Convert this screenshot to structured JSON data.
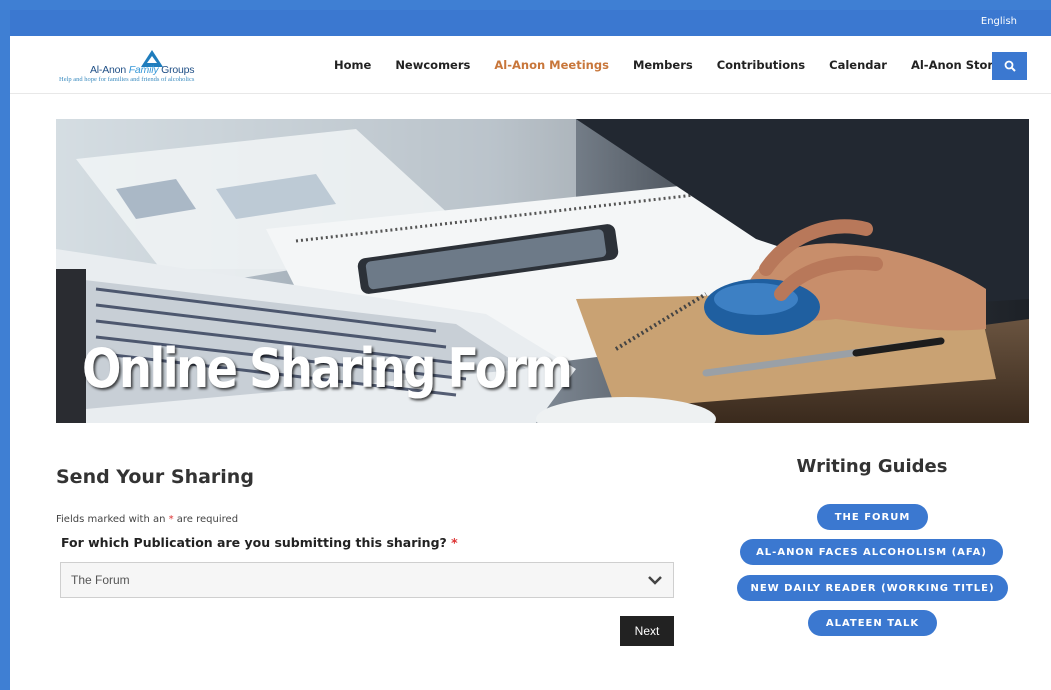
{
  "topbar": {
    "language": "English"
  },
  "logo": {
    "name_part1": "Al-Anon ",
    "name_part2": "Family",
    "name_part3": " Groups",
    "tagline": "Help and hope for families and friends of alcoholics"
  },
  "nav": {
    "items": [
      {
        "label": "Home",
        "active": false
      },
      {
        "label": "Newcomers",
        "active": false
      },
      {
        "label": "Al-Anon Meetings",
        "active": true
      },
      {
        "label": "Members",
        "active": false
      },
      {
        "label": "Contributions",
        "active": false
      },
      {
        "label": "Calendar",
        "active": false
      },
      {
        "label": "Al-Anon Store",
        "active": false
      }
    ],
    "search_icon": "search-icon"
  },
  "hero": {
    "title": "Online Sharing Form"
  },
  "form": {
    "title": "Send Your Sharing",
    "required_note_prefix": "Fields marked with an ",
    "required_star": "*",
    "required_note_suffix": " are required",
    "question": "For which Publication are you submitting this sharing?",
    "question_star": "*",
    "selected_value": "The Forum",
    "next_label": "Next"
  },
  "guides": {
    "title": "Writing Guides",
    "items": [
      "THE FORUM",
      "AL-ANON FACES ALCOHOLISM (AFA)",
      "NEW DAILY READER (WORKING TITLE)",
      "ALATEEN TALK"
    ]
  },
  "colors": {
    "brand_blue": "#3b78d0",
    "active_nav": "#c8763a",
    "required": "#dd3333"
  }
}
